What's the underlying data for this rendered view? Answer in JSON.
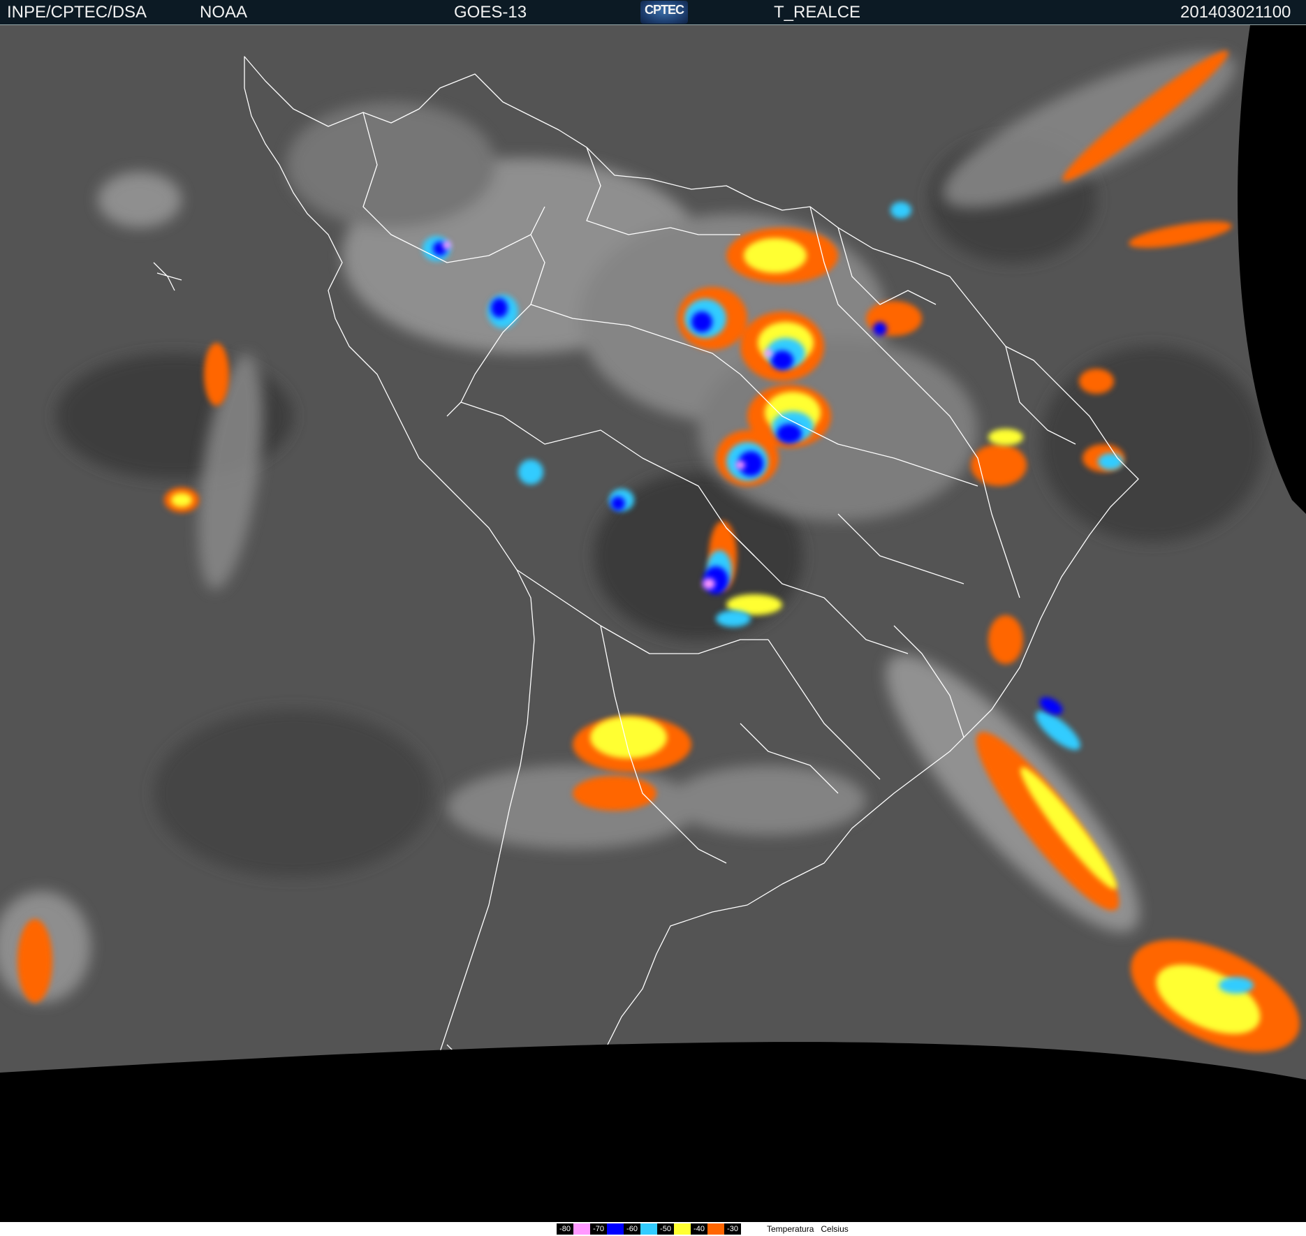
{
  "header": {
    "org": "INPE/CPTEC/DSA",
    "agency": "NOAA",
    "satellite": "GOES-13",
    "logo_text": "CPTEC",
    "product": "T_REALCE",
    "timestamp": "201403021100"
  },
  "legend": {
    "title": "Temperatura",
    "unit": "Celsius",
    "entries": [
      {
        "label": "-80",
        "color": "#ff99ff"
      },
      {
        "label": "-70",
        "color": "#0000ff"
      },
      {
        "label": "-60",
        "color": "#33ccff"
      },
      {
        "label": "-50",
        "color": "#ffff33"
      },
      {
        "label": "-40",
        "color": "#ff6600"
      },
      {
        "label": "-30",
        "color": "#ff6600"
      }
    ]
  },
  "map": {
    "base_gray": "#5a5a5a",
    "cloud_gray": "#a8a8a8",
    "space_color": "#000000",
    "border_color": "#ffffff"
  }
}
